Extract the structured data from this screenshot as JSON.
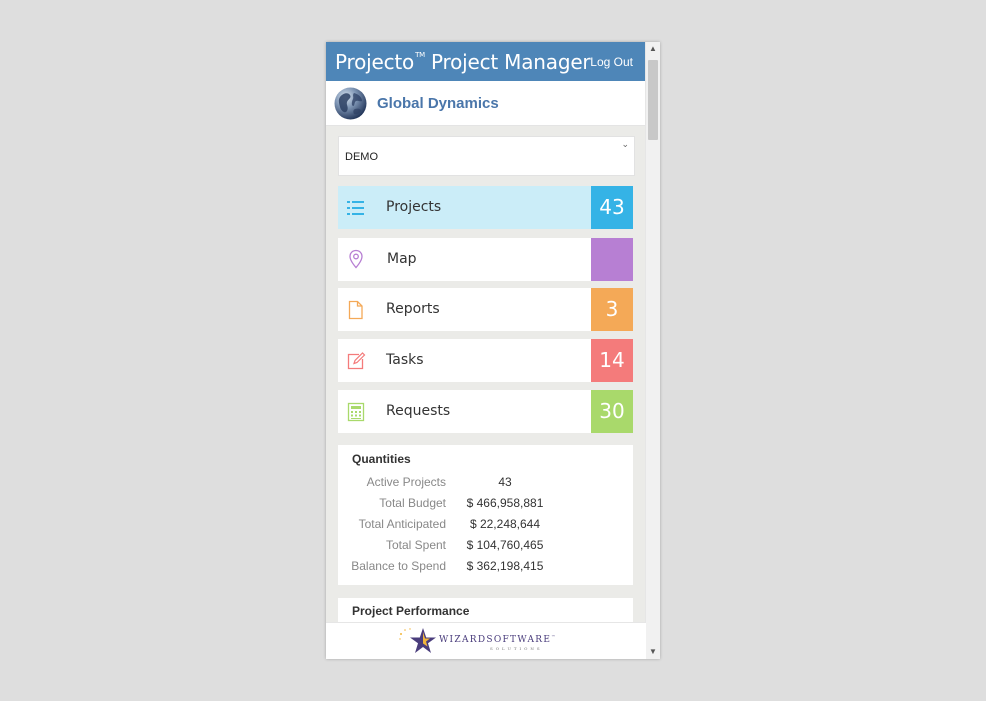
{
  "app": {
    "title": "Projecto",
    "trademark": "TM",
    "subtitle": "Project Manager",
    "logout_label": "Log Out"
  },
  "company": {
    "name": "Global Dynamics",
    "icon": "globe-icon"
  },
  "selector": {
    "value": "DEMO"
  },
  "tiles": [
    {
      "label": "Projects",
      "count": "43",
      "icon": "list-icon",
      "color": "#35b3e6",
      "active": true
    },
    {
      "label": "Map",
      "count": "",
      "icon": "map-pin-icon",
      "color": "#b77fd3",
      "active": false
    },
    {
      "label": "Reports",
      "count": "3",
      "icon": "document-icon",
      "color": "#f4a957",
      "active": false
    },
    {
      "label": "Tasks",
      "count": "14",
      "icon": "edit-icon",
      "color": "#f47b7b",
      "active": false
    },
    {
      "label": "Requests",
      "count": "30",
      "icon": "calculator-icon",
      "color": "#a9d96b",
      "active": false
    }
  ],
  "quantities": {
    "title": "Quantities",
    "rows": [
      {
        "label": "Active Projects",
        "value": "43"
      },
      {
        "label": "Total Budget",
        "value": "$ 466,958,881"
      },
      {
        "label": "Total Anticipated",
        "value": "$ 22,248,644"
      },
      {
        "label": "Total Spent",
        "value": "$ 104,760,465"
      },
      {
        "label": "Balance to Spend",
        "value": "$ 362,198,415"
      }
    ]
  },
  "performance": {
    "title": "Project Performance"
  },
  "footer": {
    "brand": "WIZARDSOFTWARE",
    "trademark": "™",
    "tagline": "SOLUTIONS"
  }
}
